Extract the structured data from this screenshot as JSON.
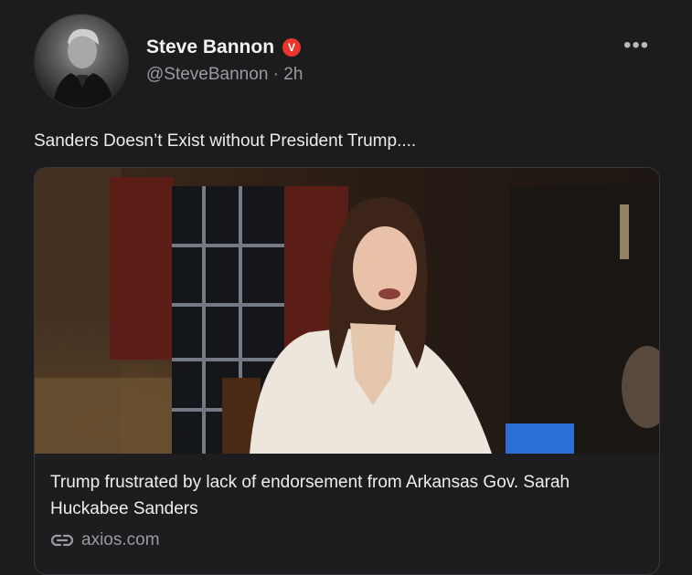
{
  "author": {
    "name": "Steve Bannon",
    "verified_badge": "V",
    "handle": "@SteveBannon",
    "time": "2h",
    "separator": "·"
  },
  "post": {
    "text": "Sanders Doesn’t Exist without President Trump...."
  },
  "link_card": {
    "title": "Trump frustrated by lack of endorsement from Arkansas Gov. Sarah Huckabee Sanders",
    "domain": "axios.com"
  },
  "icons": {
    "more": "more-icon",
    "link": "link-icon",
    "verified": "verified-badge-icon"
  },
  "colors": {
    "background": "#1c1c1e",
    "verified_badge": "#e8362f",
    "secondary_text": "#9a9aa0"
  }
}
